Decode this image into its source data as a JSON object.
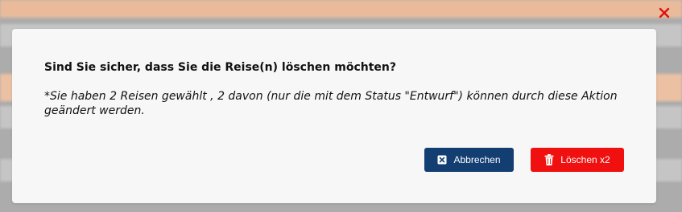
{
  "dialog": {
    "question": "Sind Sie sicher, dass Sie die Reise(n) löschen möchten?",
    "note": "*Sie haben 2 Reisen gewählt , 2 davon (nur die mit dem Status \"Entwurf\") können durch diese Aktion geändert werden.",
    "cancel_label": "Abbrechen",
    "delete_label": "Löschen x2"
  },
  "icons": {
    "close": "close-icon",
    "cancel": "cancel-square-icon",
    "delete": "trash-icon"
  },
  "colors": {
    "cancel_button": "#123e72",
    "delete_button": "#f01010",
    "close_icon": "#e01010"
  }
}
